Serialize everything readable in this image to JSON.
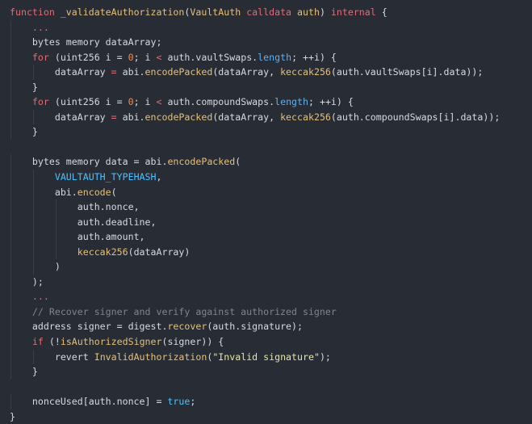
{
  "colors": {
    "background": "#282c34",
    "default_text": "#d7dae0",
    "keyword": "#e06c75",
    "function": "#e5c07b",
    "number": "#f28b54",
    "property": "#61afef",
    "constant": "#4fc1ff",
    "string": "#e5e5a6",
    "comment": "#7f848e"
  },
  "code": {
    "lines": [
      {
        "indent": 0,
        "tokens": [
          [
            "kw",
            "function"
          ],
          [
            "default",
            " "
          ],
          [
            "fn",
            "_validateAuthorization"
          ],
          [
            "punct",
            "("
          ],
          [
            "type",
            "VaultAuth"
          ],
          [
            "default",
            " "
          ],
          [
            "kw",
            "calldata"
          ],
          [
            "default",
            " "
          ],
          [
            "type",
            "auth"
          ],
          [
            "punct",
            ")"
          ],
          [
            "default",
            " "
          ],
          [
            "kw",
            "internal"
          ],
          [
            "default",
            " "
          ],
          [
            "punct",
            "{"
          ]
        ]
      },
      {
        "indent": 1,
        "tokens": [
          [
            "kw",
            "..."
          ]
        ]
      },
      {
        "indent": 1,
        "tokens": [
          [
            "default",
            "bytes memory dataArray;"
          ]
        ]
      },
      {
        "indent": 1,
        "tokens": [
          [
            "kw",
            "for"
          ],
          [
            "default",
            " (uint256 i = "
          ],
          [
            "num",
            "0"
          ],
          [
            "default",
            "; i "
          ],
          [
            "kw",
            "<"
          ],
          [
            "default",
            " auth.vaultSwaps."
          ],
          [
            "prop",
            "length"
          ],
          [
            "default",
            "; ++i) {"
          ]
        ]
      },
      {
        "indent": 2,
        "tokens": [
          [
            "default",
            "dataArray "
          ],
          [
            "kw",
            "="
          ],
          [
            "default",
            " abi."
          ],
          [
            "fn",
            "encodePacked"
          ],
          [
            "default",
            "(dataArray, "
          ],
          [
            "fn",
            "keccak256"
          ],
          [
            "default",
            "(auth.vaultSwaps[i].data));"
          ]
        ]
      },
      {
        "indent": 1,
        "tokens": [
          [
            "default",
            "}"
          ]
        ]
      },
      {
        "indent": 1,
        "tokens": [
          [
            "kw",
            "for"
          ],
          [
            "default",
            " (uint256 i = "
          ],
          [
            "num",
            "0"
          ],
          [
            "default",
            "; i "
          ],
          [
            "kw",
            "<"
          ],
          [
            "default",
            " auth.compoundSwaps."
          ],
          [
            "prop",
            "length"
          ],
          [
            "default",
            "; ++i) {"
          ]
        ]
      },
      {
        "indent": 2,
        "tokens": [
          [
            "default",
            "dataArray "
          ],
          [
            "kw",
            "="
          ],
          [
            "default",
            " abi."
          ],
          [
            "fn",
            "encodePacked"
          ],
          [
            "default",
            "(dataArray, "
          ],
          [
            "fn",
            "keccak256"
          ],
          [
            "default",
            "(auth.compoundSwaps[i].data));"
          ]
        ]
      },
      {
        "indent": 1,
        "tokens": [
          [
            "default",
            "}"
          ]
        ]
      },
      {
        "indent": 0,
        "tokens": []
      },
      {
        "indent": 1,
        "tokens": [
          [
            "default",
            "bytes memory data = abi."
          ],
          [
            "fn",
            "encodePacked"
          ],
          [
            "default",
            "("
          ]
        ]
      },
      {
        "indent": 2,
        "tokens": [
          [
            "const",
            "VAULTAUTH_TYPEHASH"
          ],
          [
            "default",
            ","
          ]
        ]
      },
      {
        "indent": 2,
        "tokens": [
          [
            "default",
            "abi."
          ],
          [
            "fn",
            "encode"
          ],
          [
            "default",
            "("
          ]
        ]
      },
      {
        "indent": 3,
        "tokens": [
          [
            "default",
            "auth.nonce,"
          ]
        ]
      },
      {
        "indent": 3,
        "tokens": [
          [
            "default",
            "auth.deadline,"
          ]
        ]
      },
      {
        "indent": 3,
        "tokens": [
          [
            "default",
            "auth.amount,"
          ]
        ]
      },
      {
        "indent": 3,
        "tokens": [
          [
            "fn",
            "keccak256"
          ],
          [
            "default",
            "(dataArray)"
          ]
        ]
      },
      {
        "indent": 2,
        "tokens": [
          [
            "default",
            ")"
          ]
        ]
      },
      {
        "indent": 1,
        "tokens": [
          [
            "default",
            ");"
          ]
        ]
      },
      {
        "indent": 1,
        "tokens": [
          [
            "kw",
            "..."
          ]
        ]
      },
      {
        "indent": 1,
        "tokens": [
          [
            "comment",
            "// Recover signer and verify against authorized signer"
          ]
        ]
      },
      {
        "indent": 1,
        "tokens": [
          [
            "default",
            "address signer = digest."
          ],
          [
            "fn",
            "recover"
          ],
          [
            "default",
            "(auth.signature);"
          ]
        ]
      },
      {
        "indent": 1,
        "tokens": [
          [
            "kw",
            "if"
          ],
          [
            "default",
            " (!"
          ],
          [
            "fn",
            "isAuthorizedSigner"
          ],
          [
            "default",
            "(signer)) {"
          ]
        ]
      },
      {
        "indent": 2,
        "tokens": [
          [
            "default",
            "revert "
          ],
          [
            "fn",
            "InvalidAuthorization"
          ],
          [
            "default",
            "("
          ],
          [
            "str",
            "\"Invalid signature\""
          ],
          [
            "default",
            ");"
          ]
        ]
      },
      {
        "indent": 1,
        "tokens": [
          [
            "default",
            "}"
          ]
        ]
      },
      {
        "indent": 0,
        "tokens": []
      },
      {
        "indent": 1,
        "tokens": [
          [
            "default",
            "nonceUsed[auth.nonce] = "
          ],
          [
            "bool",
            "true"
          ],
          [
            "default",
            ";"
          ]
        ]
      },
      {
        "indent": 0,
        "tokens": [
          [
            "default",
            "}"
          ]
        ]
      }
    ]
  }
}
